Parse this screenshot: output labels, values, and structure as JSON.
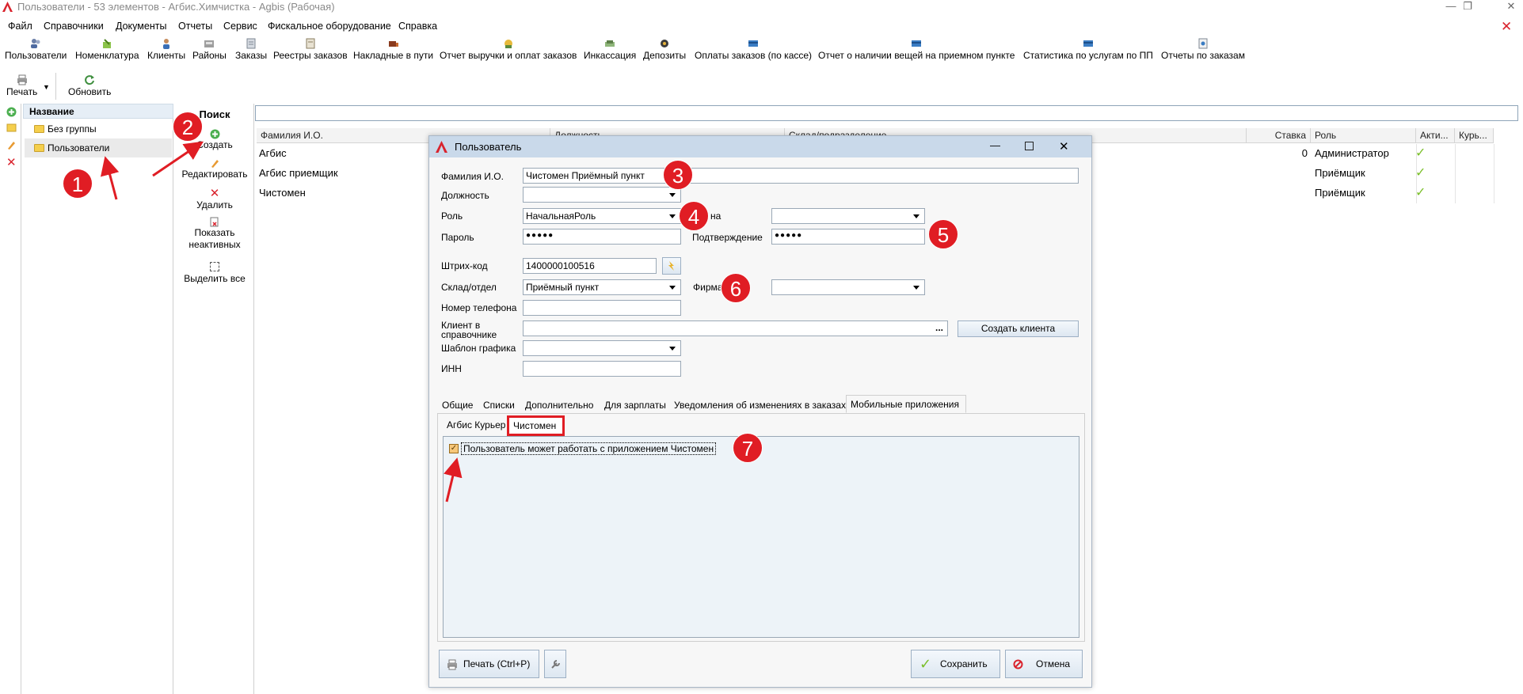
{
  "window": {
    "title": "Пользователи - 53 элементов - Агбис.Химчистка - Agbis (Рабочая)"
  },
  "menu": [
    "Файл",
    "Справочники",
    "Документы",
    "Отчеты",
    "Сервис",
    "Фискальное оборудование",
    "Справка"
  ],
  "toolbar": [
    "Пользователи",
    "Номенклатура",
    "Клиенты",
    "Районы",
    "Заказы",
    "Реестры заказов",
    "Накладные в пути",
    "Отчет выручки и оплат заказов",
    "Инкассация",
    "Депозиты",
    "Оплаты заказов (по кассе)",
    "Отчет о наличии вещей на приемном пункте",
    "Статистика по услугам по ПП",
    "Отчеты по заказам"
  ],
  "toolbar2": {
    "print": "Печать",
    "refresh": "Обновить"
  },
  "tree": {
    "header": "Название",
    "items": [
      "Без группы",
      "Пользователи"
    ]
  },
  "actions": {
    "search": "Поиск",
    "create": "Создать",
    "edit": "Редактировать",
    "delete": "Удалить",
    "show_inactive": "Показать неактивных",
    "select_all": "Выделить все"
  },
  "grid": {
    "columns": [
      "Фамилия И.О.",
      "Должность",
      "Склад/подразделение",
      "Ставка",
      "Роль",
      "Акти...",
      "Курь..."
    ],
    "rows": [
      {
        "name": "Агбис",
        "rate": "0",
        "role": "Администратор"
      },
      {
        "name": "Агбис приемщик",
        "rate": "",
        "role": "Приёмщик"
      },
      {
        "name": "Чистомен",
        "rate": "",
        "role": "Приёмщик"
      }
    ]
  },
  "dialog": {
    "title": "Пользователь",
    "labels": {
      "fio": "Фамилия И.О.",
      "position": "Должность",
      "role": "Роль",
      "password": "Пароль",
      "confirm": "Подтверждение",
      "shift": "на",
      "barcode": "Штрих-код",
      "warehouse": "Склад/отдел",
      "firm": "Фирма",
      "phone": "Номер телефона",
      "client": "Клиент в справочнике",
      "schedule": "Шаблон графика",
      "inn": "ИНН"
    },
    "values": {
      "fio": "Чистомен Приёмный пункт",
      "role": "НачальнаяРоль",
      "password": "●●●●●",
      "confirm": "●●●●●",
      "barcode": "1400000100516",
      "warehouse": "Приёмный пункт",
      "client_dots": "..."
    },
    "create_client": "Создать клиента",
    "tabs": [
      "Общие",
      "Списки",
      "Дополнительно",
      "Для зарплаты",
      "Уведомления об изменениях в заказах",
      "Мобильные приложения"
    ],
    "subtabs": [
      "Агбис Курьер",
      "Чистомен"
    ],
    "checkbox_label": "Пользователь может работать с приложением Чистомен",
    "print_button": "Печать (Ctrl+P)",
    "save_button": "Сохранить",
    "cancel_button": "Отмена"
  },
  "badges": [
    "1",
    "2",
    "3",
    "4",
    "5",
    "6",
    "7"
  ],
  "colors": {
    "badge": "#e01d24",
    "title_bar": "#c9d9ea",
    "accent_check": "#7bbf2a"
  }
}
